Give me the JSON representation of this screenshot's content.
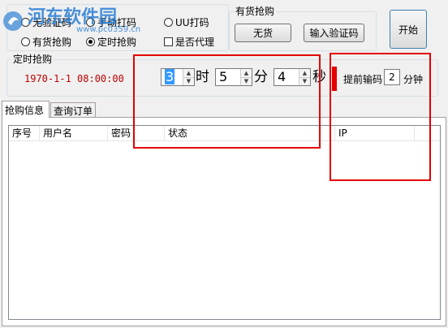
{
  "options_group": {
    "radios_row1": [
      {
        "label": "无验证码",
        "checked": false
      },
      {
        "label": "手动打码",
        "checked": false
      },
      {
        "label": "UU打码",
        "checked": false
      }
    ],
    "radios_row2": [
      {
        "label": "有货抢购",
        "checked": false
      },
      {
        "label": "定时抢购",
        "checked": true
      }
    ],
    "proxy_checkbox": {
      "label": "是否代理",
      "checked": false
    }
  },
  "stock_group": {
    "title": "有货抢购",
    "status_button": "无货",
    "captcha_button": "输入验证码"
  },
  "start_button": "开始",
  "timer_group": {
    "title": "定时抢购",
    "datetime": "1970-1-1 08:00:00",
    "hour": "3",
    "hour_unit": "时",
    "minute": "5",
    "minute_unit": "分",
    "second": "4",
    "second_unit": "秒",
    "advance_label": "提前输码",
    "advance_value": "2",
    "advance_unit": "分钟"
  },
  "tabs": [
    {
      "label": "抢购信息",
      "active": true
    },
    {
      "label": "查询订单",
      "active": false
    }
  ],
  "table": {
    "columns": [
      "序号",
      "用户名",
      "密码",
      "状态",
      "IP"
    ],
    "rows": []
  },
  "watermark": {
    "text": "河东软件园",
    "url": "www.pc0359.cn"
  },
  "colors": {
    "highlight_red": "#e30000",
    "watermark_blue": "#2a7fd4",
    "date_red": "#c00000"
  }
}
